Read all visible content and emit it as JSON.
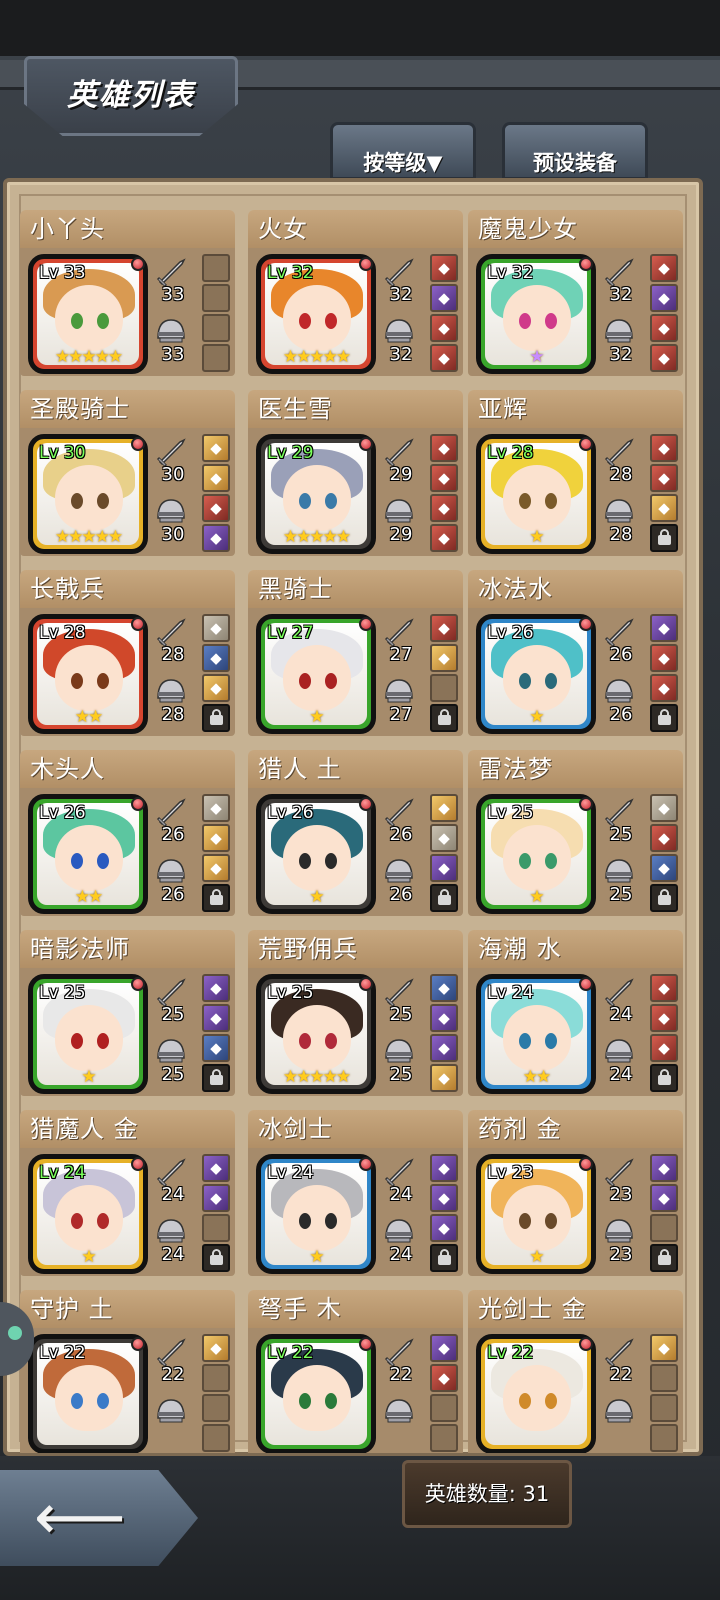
{
  "title": "英雄列表",
  "tabs": {
    "sort_label": "按等级▼",
    "preset_label": "预设装备"
  },
  "hero_count_label": "英雄数量: 31",
  "colors": {
    "frame_red": "#d5452f",
    "frame_green": "#39a52b",
    "frame_blue": "#2f86c8",
    "frame_yellow": "#e6b127",
    "frame_dark": "#3d3a37"
  },
  "heroes": [
    {
      "name": "小丫头",
      "level": "Lv 33",
      "lv_green": false,
      "frame": "red",
      "hair": "#d99a52",
      "eye": "#4a9a3c",
      "stars": "★★★★★",
      "star_color": "gold",
      "weapon": "33",
      "armor": "33",
      "slots": [
        "empty",
        "empty",
        "empty",
        "empty"
      ]
    },
    {
      "name": "火女",
      "level": "Lv 32",
      "lv_green": true,
      "frame": "red",
      "hair": "#e8862b",
      "eye": "#c0282a",
      "stars": "★★★★★",
      "star_color": "gold",
      "weapon": "32",
      "armor": "32",
      "slots": [
        "red",
        "purple",
        "red",
        "red"
      ]
    },
    {
      "name": "魔鬼少女",
      "level": "Lv 32",
      "lv_green": false,
      "frame": "green",
      "hair": "#6fd2b6",
      "eye": "#d03a8a",
      "stars": "★",
      "star_color": "purple",
      "weapon": "32",
      "armor": "32",
      "slots": [
        "red",
        "purple",
        "red",
        "red"
      ]
    },
    {
      "name": "圣殿骑士",
      "level": "Lv 30",
      "lv_green": true,
      "frame": "yellow",
      "hair": "#e8d08a",
      "eye": "#6a4a2a",
      "stars": "★★★★★",
      "star_color": "gold",
      "weapon": "30",
      "armor": "30",
      "slots": [
        "orange",
        "orange",
        "red",
        "purple"
      ]
    },
    {
      "name": "医生雪",
      "level": "Lv 29",
      "lv_green": true,
      "frame": "dark",
      "hair": "#9aa0b8",
      "eye": "#3a7aa8",
      "stars": "★★★★★",
      "star_color": "gold",
      "weapon": "29",
      "armor": "29",
      "slots": [
        "red",
        "red",
        "red",
        "red"
      ]
    },
    {
      "name": "亚辉",
      "level": "Lv 28",
      "lv_green": true,
      "frame": "yellow",
      "hair": "#f0d23c",
      "eye": "#7a5a2a",
      "stars": "★",
      "star_color": "gold",
      "weapon": "28",
      "armor": "28",
      "slots": [
        "red",
        "red",
        "orange",
        "lock"
      ]
    },
    {
      "name": "长戟兵",
      "level": "Lv 28",
      "lv_green": false,
      "frame": "red",
      "hair": "#d0482a",
      "eye": "#7a3a1a",
      "stars": "★★",
      "star_color": "gold",
      "weapon": "28",
      "armor": "28",
      "slots": [
        "gray",
        "blue",
        "orange",
        "lock"
      ]
    },
    {
      "name": "黑骑士",
      "level": "Lv 27",
      "lv_green": true,
      "frame": "green",
      "hair": "#e6e6ea",
      "eye": "#aa2222",
      "stars": "★",
      "star_color": "gold",
      "weapon": "27",
      "armor": "27",
      "slots": [
        "red",
        "orange",
        "empty",
        "lock"
      ]
    },
    {
      "name": "冰法水",
      "level": "Lv 26",
      "lv_green": false,
      "frame": "blue",
      "hair": "#4fc0c8",
      "eye": "#2a6a7a",
      "stars": "★",
      "star_color": "gold",
      "weapon": "26",
      "armor": "26",
      "slots": [
        "purple",
        "red",
        "red",
        "lock"
      ]
    },
    {
      "name": "木头人",
      "level": "Lv 26",
      "lv_green": false,
      "frame": "green",
      "hair": "#5cc6a0",
      "eye": "#2a5ac0",
      "stars": "★★",
      "star_color": "gold",
      "weapon": "26",
      "armor": "26",
      "slots": [
        "gray",
        "orange",
        "orange",
        "lock"
      ]
    },
    {
      "name": "猎人 土",
      "level": "Lv 26",
      "lv_green": false,
      "frame": "dark",
      "hair": "#2a6a7a",
      "eye": "#2a2a2a",
      "stars": "★",
      "star_color": "gold",
      "weapon": "26",
      "armor": "26",
      "slots": [
        "orange",
        "gray",
        "purple",
        "lock"
      ]
    },
    {
      "name": "雷法梦",
      "level": "Lv 25",
      "lv_green": false,
      "frame": "green",
      "hair": "#f6ddb0",
      "eye": "#3a9a6a",
      "stars": "★",
      "star_color": "gold",
      "weapon": "25",
      "armor": "25",
      "slots": [
        "gray",
        "red",
        "blue",
        "lock"
      ]
    },
    {
      "name": "暗影法师",
      "level": "Lv 25",
      "lv_green": false,
      "frame": "green",
      "hair": "#e8e8e8",
      "eye": "#b02020",
      "stars": "★",
      "star_color": "gold",
      "weapon": "25",
      "armor": "25",
      "slots": [
        "purple",
        "purple",
        "blue",
        "lock"
      ]
    },
    {
      "name": "荒野佣兵",
      "level": "Lv 25",
      "lv_green": false,
      "frame": "dark",
      "hair": "#3a2a22",
      "eye": "#b02a3a",
      "stars": "★★★★★",
      "star_color": "gold",
      "weapon": "25",
      "armor": "25",
      "slots": [
        "blue",
        "purple",
        "purple",
        "orange"
      ]
    },
    {
      "name": "海潮 水",
      "level": "Lv 24",
      "lv_green": false,
      "frame": "blue",
      "hair": "#8adcd8",
      "eye": "#2a7aa8",
      "stars": "★★",
      "star_color": "gold",
      "weapon": "24",
      "armor": "24",
      "slots": [
        "red",
        "red",
        "red",
        "lock"
      ]
    },
    {
      "name": "猎魔人 金",
      "level": "Lv 24",
      "lv_green": true,
      "frame": "yellow",
      "hair": "#c8c4d8",
      "eye": "#b02a2a",
      "stars": "★",
      "star_color": "gold",
      "weapon": "24",
      "armor": "24",
      "slots": [
        "purple",
        "purple",
        "empty",
        "lock"
      ]
    },
    {
      "name": "冰剑士",
      "level": "Lv 24",
      "lv_green": false,
      "frame": "blue",
      "hair": "#b8b8bc",
      "eye": "#2a2a2a",
      "stars": "★",
      "star_color": "gold",
      "weapon": "24",
      "armor": "24",
      "slots": [
        "purple",
        "purple",
        "purple",
        "lock"
      ]
    },
    {
      "name": "药剂 金",
      "level": "Lv 23",
      "lv_green": false,
      "frame": "yellow",
      "hair": "#f0b45a",
      "eye": "#6a4a2a",
      "stars": "★",
      "star_color": "gold",
      "weapon": "23",
      "armor": "23",
      "slots": [
        "purple",
        "purple",
        "empty",
        "lock"
      ]
    },
    {
      "name": "守护 土",
      "level": "Lv 22",
      "lv_green": false,
      "frame": "dark",
      "hair": "#c06a3a",
      "eye": "#3a7ac8",
      "stars": "",
      "star_color": "gold",
      "weapon": "22",
      "armor": "",
      "slots": [
        "orange",
        "empty",
        "empty",
        "empty"
      ]
    },
    {
      "name": "弩手 木",
      "level": "Lv 22",
      "lv_green": true,
      "frame": "green",
      "hair": "#2a3a4a",
      "eye": "#2a7a3a",
      "stars": "",
      "star_color": "gold",
      "weapon": "22",
      "armor": "",
      "slots": [
        "purple",
        "red",
        "empty",
        "empty"
      ]
    },
    {
      "name": "光剑士 金",
      "level": "Lv 22",
      "lv_green": true,
      "frame": "yellow",
      "hair": "#ece8e0",
      "eye": "#d08a2a",
      "stars": "",
      "star_color": "gold",
      "weapon": "22",
      "armor": "",
      "slots": [
        "orange",
        "empty",
        "empty",
        "empty"
      ]
    }
  ]
}
